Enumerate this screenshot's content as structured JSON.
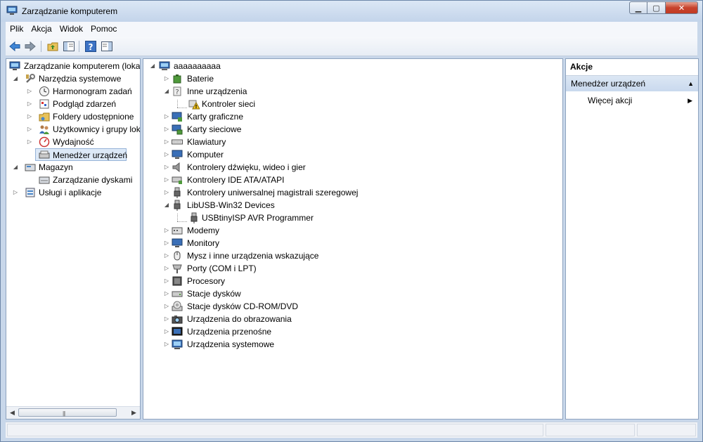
{
  "window": {
    "title": "Zarządzanie komputerem"
  },
  "menu": [
    "Plik",
    "Akcja",
    "Widok",
    "Pomoc"
  ],
  "left_tree": [
    {
      "label": "Zarządzanie komputerem (loka",
      "icon": "computer-management-icon"
    },
    {
      "label": "Narzędzia systemowe",
      "icon": "tools-icon"
    },
    {
      "label": "Harmonogram zadań",
      "icon": "clock-icon"
    },
    {
      "label": "Podgląd zdarzeń",
      "icon": "event-viewer-icon"
    },
    {
      "label": "Foldery udostępnione",
      "icon": "shared-folder-icon"
    },
    {
      "label": "Użytkownicy i grupy lok",
      "icon": "users-icon"
    },
    {
      "label": "Wydajność",
      "icon": "performance-icon"
    },
    {
      "label": "Menedżer urządzeń",
      "icon": "device-manager-icon"
    },
    {
      "label": "Magazyn",
      "icon": "storage-icon"
    },
    {
      "label": "Zarządzanie dyskami",
      "icon": "disk-management-icon"
    },
    {
      "label": "Usługi i aplikacje",
      "icon": "services-icon"
    }
  ],
  "device_tree": [
    {
      "label": "aaaaaaaaaa",
      "icon": "computer-icon"
    },
    {
      "label": "Baterie",
      "icon": "battery-icon"
    },
    {
      "label": "Inne urządzenia",
      "icon": "unknown-device-icon"
    },
    {
      "label": "Kontroler sieci",
      "icon": "warning-device-icon"
    },
    {
      "label": "Karty graficzne",
      "icon": "display-adapter-icon"
    },
    {
      "label": "Karty sieciowe",
      "icon": "network-adapter-icon"
    },
    {
      "label": "Klawiatury",
      "icon": "keyboard-icon"
    },
    {
      "label": "Komputer",
      "icon": "monitor-icon"
    },
    {
      "label": "Kontrolery dźwięku, wideo i gier",
      "icon": "speaker-icon"
    },
    {
      "label": "Kontrolery IDE ATA/ATAPI",
      "icon": "ide-controller-icon"
    },
    {
      "label": "Kontrolery uniwersalnej magistrali szeregowej",
      "icon": "usb-icon"
    },
    {
      "label": "LibUSB-Win32 Devices",
      "icon": "usb-icon"
    },
    {
      "label": "USBtinyISP AVR Programmer",
      "icon": "usb-icon"
    },
    {
      "label": "Modemy",
      "icon": "modem-icon"
    },
    {
      "label": "Monitory",
      "icon": "monitor-icon"
    },
    {
      "label": "Mysz i inne urządzenia wskazujące",
      "icon": "mouse-icon"
    },
    {
      "label": "Porty (COM i LPT)",
      "icon": "port-icon"
    },
    {
      "label": "Procesory",
      "icon": "processor-icon"
    },
    {
      "label": "Stacje dysków",
      "icon": "disk-drive-icon"
    },
    {
      "label": "Stacje dysków CD-ROM/DVD",
      "icon": "cdrom-icon"
    },
    {
      "label": "Urządzenia do obrazowania",
      "icon": "camera-icon"
    },
    {
      "label": "Urządzenia przenośne",
      "icon": "portable-device-icon"
    },
    {
      "label": "Urządzenia systemowe",
      "icon": "system-device-icon"
    }
  ],
  "actions": {
    "header": "Akcje",
    "section": "Menedżer urządzeń",
    "more": "Więcej akcji"
  }
}
